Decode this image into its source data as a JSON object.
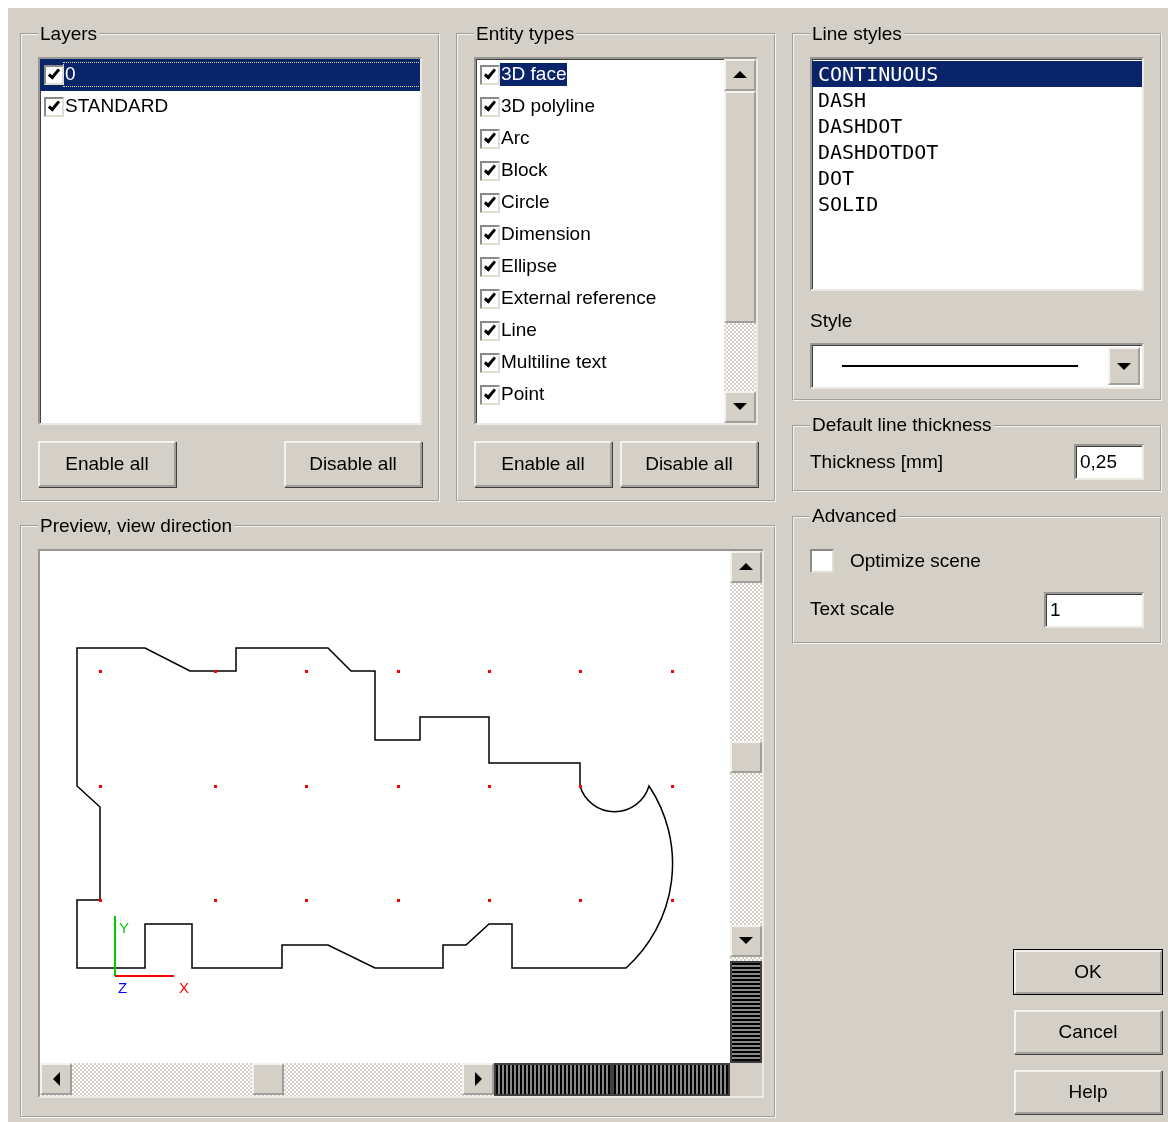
{
  "layers": {
    "title": "Layers",
    "items": [
      {
        "label": "0",
        "checked": true,
        "selected": true
      },
      {
        "label": "STANDARD",
        "checked": true,
        "selected": false
      }
    ],
    "buttons": [
      "Enable all",
      "Disable all"
    ]
  },
  "entity_types": {
    "title": "Entity types",
    "items": [
      {
        "label": "3D face",
        "checked": true,
        "selected": true
      },
      {
        "label": "3D polyline",
        "checked": true,
        "selected": false
      },
      {
        "label": "Arc",
        "checked": true,
        "selected": false
      },
      {
        "label": "Block",
        "checked": true,
        "selected": false
      },
      {
        "label": "Circle",
        "checked": true,
        "selected": false
      },
      {
        "label": "Dimension",
        "checked": true,
        "selected": false
      },
      {
        "label": "Ellipse",
        "checked": true,
        "selected": false
      },
      {
        "label": "External reference",
        "checked": true,
        "selected": false
      },
      {
        "label": "Line",
        "checked": true,
        "selected": false
      },
      {
        "label": "Multiline text",
        "checked": true,
        "selected": false
      },
      {
        "label": "Point",
        "checked": true,
        "selected": false
      }
    ],
    "buttons": [
      "Enable all",
      "Disable all"
    ]
  },
  "line_styles": {
    "title": "Line styles",
    "items": [
      {
        "label": "CONTINUOUS",
        "selected": true
      },
      {
        "label": "DASH",
        "selected": false
      },
      {
        "label": "DASHDOT",
        "selected": false
      },
      {
        "label": "DASHDOTDOT",
        "selected": false
      },
      {
        "label": "DOT",
        "selected": false
      },
      {
        "label": "SOLID",
        "selected": false
      }
    ],
    "style_label": "Style"
  },
  "default_line_thickness": {
    "title": "Default line thickness",
    "label": "Thickness [mm]",
    "value": "0,25"
  },
  "advanced": {
    "title": "Advanced",
    "optimize_scene": {
      "label": "Optimize scene",
      "checked": false
    },
    "text_scale": {
      "label": "Text scale",
      "value": "1"
    }
  },
  "preview": {
    "title": "Preview, view direction",
    "axes": [
      {
        "label": "Y"
      },
      {
        "label": "Z"
      },
      {
        "label": "X"
      }
    ]
  },
  "buttons": [
    {
      "label": "OK",
      "default": true
    },
    {
      "label": "Cancel",
      "default": false
    },
    {
      "label": "Help",
      "default": false
    }
  ]
}
